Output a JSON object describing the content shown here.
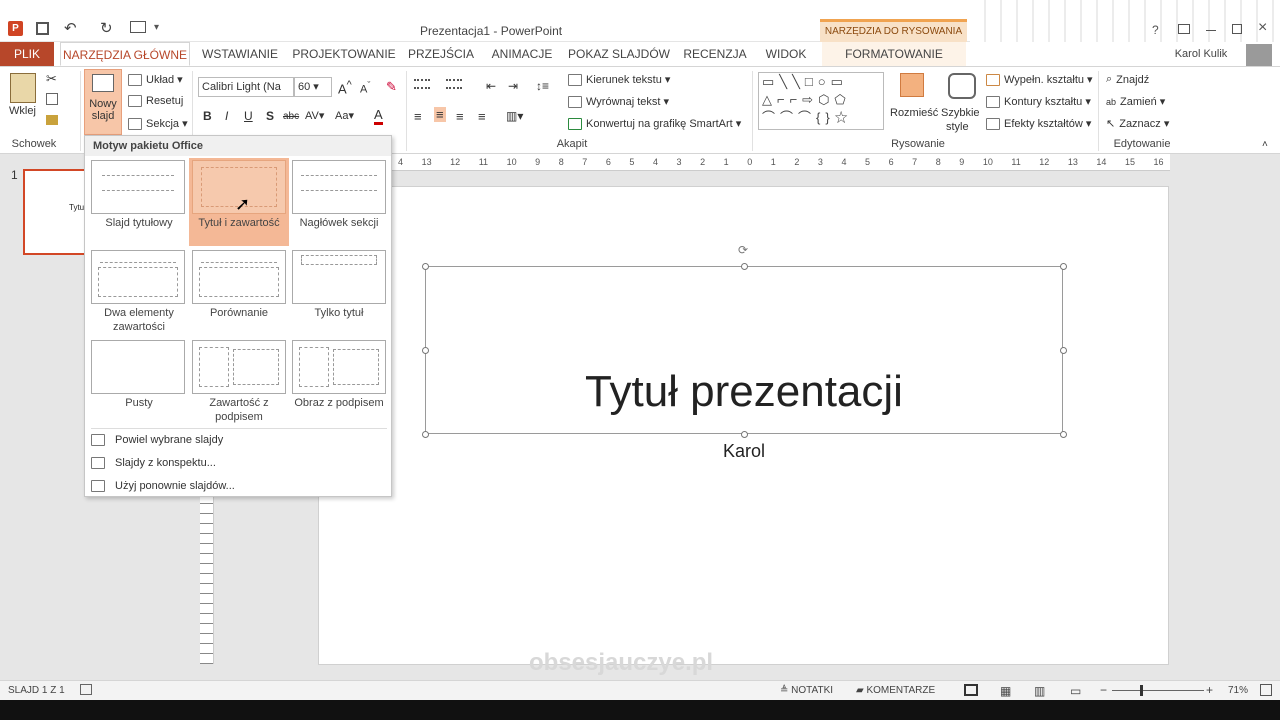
{
  "window": {
    "title": "Prezentacja1 - PowerPoint",
    "user": "Karol Kulik",
    "drawing_tools_header": "NARZĘDZIA DO RYSOWANIA"
  },
  "tabs": [
    "PLIK",
    "NARZĘDZIA GŁÓWNE",
    "WSTAWIANIE",
    "PROJEKTOWANIE",
    "PRZEJŚCIA",
    "ANIMACJE",
    "POKAZ SLAJDÓW",
    "RECENZJA",
    "WIDOK",
    "FORMATOWANIE"
  ],
  "ribbon": {
    "clipboard": {
      "paste": "Wklej",
      "label": "Schowek"
    },
    "slides": {
      "new_slide_1": "Nowy",
      "new_slide_2": "slajd",
      "layout": "Układ",
      "reset": "Resetuj",
      "section": "Sekcja"
    },
    "font": {
      "name": "Calibri Light (Na",
      "size": "60"
    },
    "paragraph": {
      "text_direction": "Kierunek tekstu",
      "align_text": "Wyrównaj tekst",
      "smartart": "Konwertuj na grafikę SmartArt",
      "label": "Akapit"
    },
    "drawing": {
      "arrange": "Rozmieść",
      "quick_styles_1": "Szybkie",
      "quick_styles_2": "style",
      "fill": "Wypełn. kształtu",
      "outline": "Kontury kształtu",
      "effects": "Efekty kształtów",
      "label": "Rysowanie"
    },
    "editing": {
      "find": "Znajdź",
      "replace": "Zamień",
      "select": "Zaznacz",
      "label": "Edytowanie"
    }
  },
  "gallery": {
    "header": "Motyw pakietu Office",
    "layouts": [
      "Slajd tytułowy",
      "Tytuł i zawartość",
      "Nagłówek sekcji",
      "Dwa elementy zawartości",
      "Porównanie",
      "Tylko tytuł",
      "Pusty",
      "Zawartość z podpisem",
      "Obraz z podpisem"
    ],
    "menu": [
      "Powiel wybrane slajdy",
      "Slajdy z konspektu...",
      "Użyj ponownie slajdów..."
    ]
  },
  "slide_panel": {
    "number": "1",
    "thumb_text": "Tytuł"
  },
  "ruler": [
    "4",
    "13",
    "12",
    "11",
    "10",
    "9",
    "8",
    "7",
    "6",
    "5",
    "4",
    "3",
    "2",
    "1",
    "0",
    "1",
    "2",
    "3",
    "4",
    "5",
    "6",
    "7",
    "8",
    "9",
    "10",
    "11",
    "12",
    "13",
    "14",
    "15",
    "16"
  ],
  "slide": {
    "title": "Tytuł prezentacji",
    "subtitle": "Karol"
  },
  "watermark": "obsesjauczye.pl",
  "status": {
    "slide": "SLAJD 1 Z 1",
    "notes": "NOTATKI",
    "comments": "KOMENTARZE",
    "zoom": "71%"
  }
}
